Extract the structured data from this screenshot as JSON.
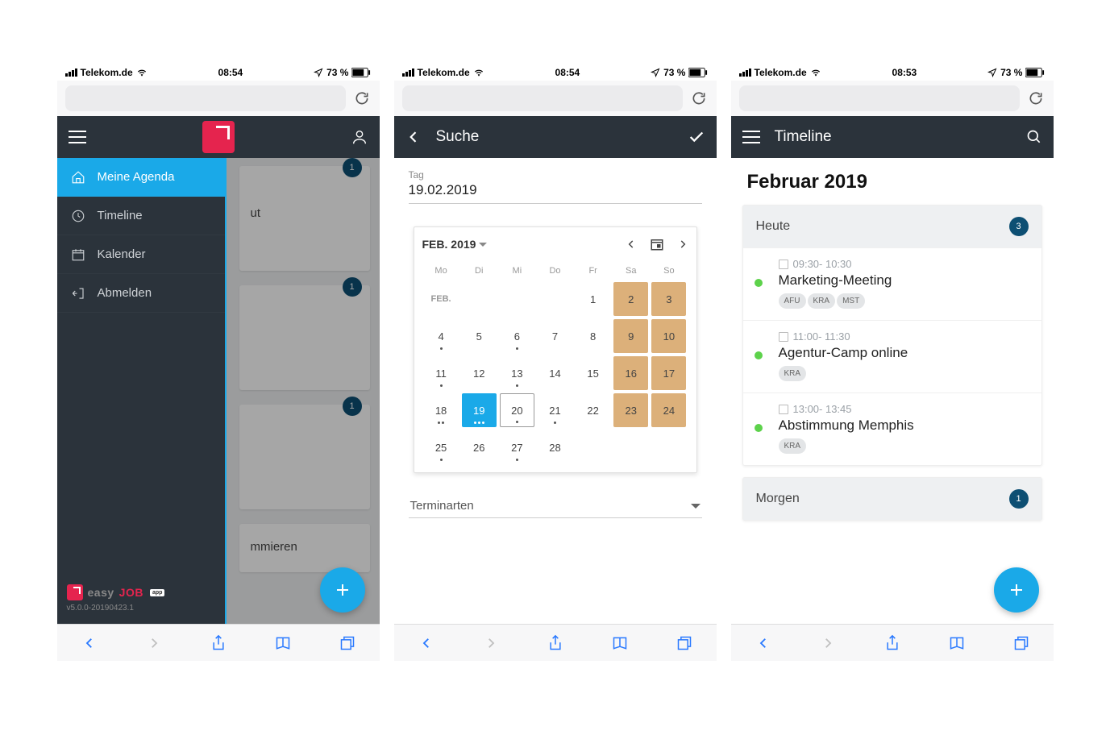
{
  "status1": {
    "carrier": "Telekom.de",
    "time": "08:54",
    "battery": "73 %"
  },
  "status2": {
    "carrier": "Telekom.de",
    "time": "08:54",
    "battery": "73 %"
  },
  "status3": {
    "carrier": "Telekom.de",
    "time": "08:53",
    "battery": "73 %"
  },
  "screen1": {
    "nav": [
      {
        "label": "Meine Agenda",
        "icon": "home"
      },
      {
        "label": "Timeline",
        "icon": "clock"
      },
      {
        "label": "Kalender",
        "icon": "calendar"
      },
      {
        "label": "Abmelden",
        "icon": "logout"
      }
    ],
    "logo_brand1": "easy",
    "logo_brand2": "JOB",
    "logo_badge": "app",
    "version": "v5.0.0-20190423.1",
    "bgcard1_badge": "1",
    "bgcard1_txt": "ut",
    "bgcard2_badge": "1",
    "bgcard3_badge": "1",
    "bgcard4_txt": "mmieren"
  },
  "screen2": {
    "header": "Suche",
    "field_label": "Tag",
    "field_value": "19.02.2019",
    "month_label": "FEB. 2019",
    "dow": [
      "Mo",
      "Di",
      "Mi",
      "Do",
      "Fr",
      "Sa",
      "So"
    ],
    "month_abbr": "FEB.",
    "dropdown": "Terminarten",
    "days": [
      {
        "t": "mlabel"
      },
      {
        "t": ""
      },
      {
        "t": ""
      },
      {
        "t": ""
      },
      {
        "n": "1",
        "d": 0
      },
      {
        "n": "2",
        "w": true,
        "d": 0
      },
      {
        "n": "3",
        "w": true,
        "d": 0
      },
      {
        "n": "4",
        "d": 1
      },
      {
        "n": "5",
        "d": 0
      },
      {
        "n": "6",
        "d": 1
      },
      {
        "n": "7",
        "d": 0
      },
      {
        "n": "8",
        "d": 0
      },
      {
        "n": "9",
        "w": true,
        "d": 0
      },
      {
        "n": "10",
        "w": true,
        "d": 0
      },
      {
        "n": "11",
        "d": 1
      },
      {
        "n": "12",
        "d": 0
      },
      {
        "n": "13",
        "d": 1
      },
      {
        "n": "14",
        "d": 0
      },
      {
        "n": "15",
        "d": 0
      },
      {
        "n": "16",
        "w": true,
        "d": 0
      },
      {
        "n": "17",
        "w": true,
        "d": 0
      },
      {
        "n": "18",
        "d": 2
      },
      {
        "n": "19",
        "sel": true,
        "d": 3
      },
      {
        "n": "20",
        "today": true,
        "d": 1
      },
      {
        "n": "21",
        "d": 1
      },
      {
        "n": "22",
        "d": 0
      },
      {
        "n": "23",
        "w": true,
        "d": 0
      },
      {
        "n": "24",
        "w": true,
        "d": 0
      },
      {
        "n": "25",
        "d": 1
      },
      {
        "n": "26",
        "d": 0
      },
      {
        "n": "27",
        "d": 1
      },
      {
        "n": "28",
        "d": 0
      },
      {
        "t": ""
      },
      {
        "t": ""
      },
      {
        "t": ""
      }
    ]
  },
  "screen3": {
    "header": "Timeline",
    "month": "Februar 2019",
    "group1_label": "Heute",
    "group1_count": "3",
    "events": [
      {
        "time": "09:30- 10:30",
        "title": "Marketing-Meeting",
        "tags": [
          "AFU",
          "KRA",
          "MST"
        ]
      },
      {
        "time": "11:00- 11:30",
        "title": "Agentur-Camp online",
        "tags": [
          "KRA"
        ]
      },
      {
        "time": "13:00- 13:45",
        "title": "Abstimmung Memphis",
        "tags": [
          "KRA"
        ]
      }
    ],
    "group2_label": "Morgen",
    "group2_count": "1"
  }
}
